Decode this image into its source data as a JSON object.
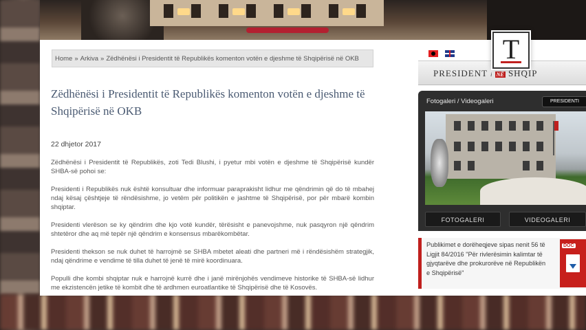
{
  "breadcrumb": {
    "home": "Home",
    "archive": "Arkiva",
    "current": "Zëdhënësi i Presidentit të Republikës komenton votën e djeshme të Shqipërisë në OKB",
    "separator": "»"
  },
  "article": {
    "title": "Zëdhënësi i Presidentit të Republikës komenton votën e djeshme të Shqipërisë në OKB",
    "date": "22 dhjetor 2017",
    "paragraphs": [
      "Zëdhënësi i Presidentit të Republikës, zoti Tedi Blushi, i pyetur mbi votën e djeshme të Shqipërisë kundër SHBA-së pohoi se:",
      "Presidenti i Republikës nuk është konsultuar dhe informuar paraprakisht lidhur me qëndrimin që do të mbahej ndaj kësaj çështjeje të rëndësishme, jo vetëm për politikën e jashtme të Shqipërisë, por për mbarë kombin shqiptar.",
      "Presidenti vlerëson se ky qëndrim dhe kjo votë kundër, tërësisht e panevojshme, nuk pasqyron një qëndrim shtetëror dhe aq më tepër një qëndrim e konsensus mbarëkombëtar.",
      "Presidenti thekson se nuk duhet të harrojmë se SHBA mbetet aleati dhe partneri më i rëndësishëm strategjik, ndaj qëndrime e vendime të tilla duhet të jenë të mirë koordinuara.",
      "Populli dhe kombi shqiptar nuk e harrojnë kurrë dhe i janë mirënjohës vendimeve historike të SHBA-së lidhur me ekzistencën jetike të kombit dhe të ardhmen euroatlantike të Shqipërisë dhe të Kosovës."
    ]
  },
  "sidebar": {
    "languages": [
      "Shqip",
      "English"
    ],
    "logo": {
      "president": "PRESIDENT",
      "i": "i",
      "ne": "NË",
      "shqip": "SHQIP"
    },
    "gallery": {
      "header": "Fotogaleri / Videogaleri",
      "small_button": "PRESIDENTI",
      "tab_photo": "FOTOGALERI",
      "tab_video": "VIDEOGALERI"
    },
    "notice": {
      "text": "Publikimet e dorëheqjeve sipas nenit 56 të Ligjit 84/2016 \"Për rivlerësimin kalimtar të gjyqtarëve dhe prokurorëve në Republikën e Shqipërisë\"",
      "doc_label": "DOC"
    }
  },
  "overlay": {
    "tv_logo": "T"
  },
  "colors": {
    "title_blue": "#4a5a72",
    "accent_red": "#c0201e",
    "gallery_dark": "#2e2e2e"
  }
}
